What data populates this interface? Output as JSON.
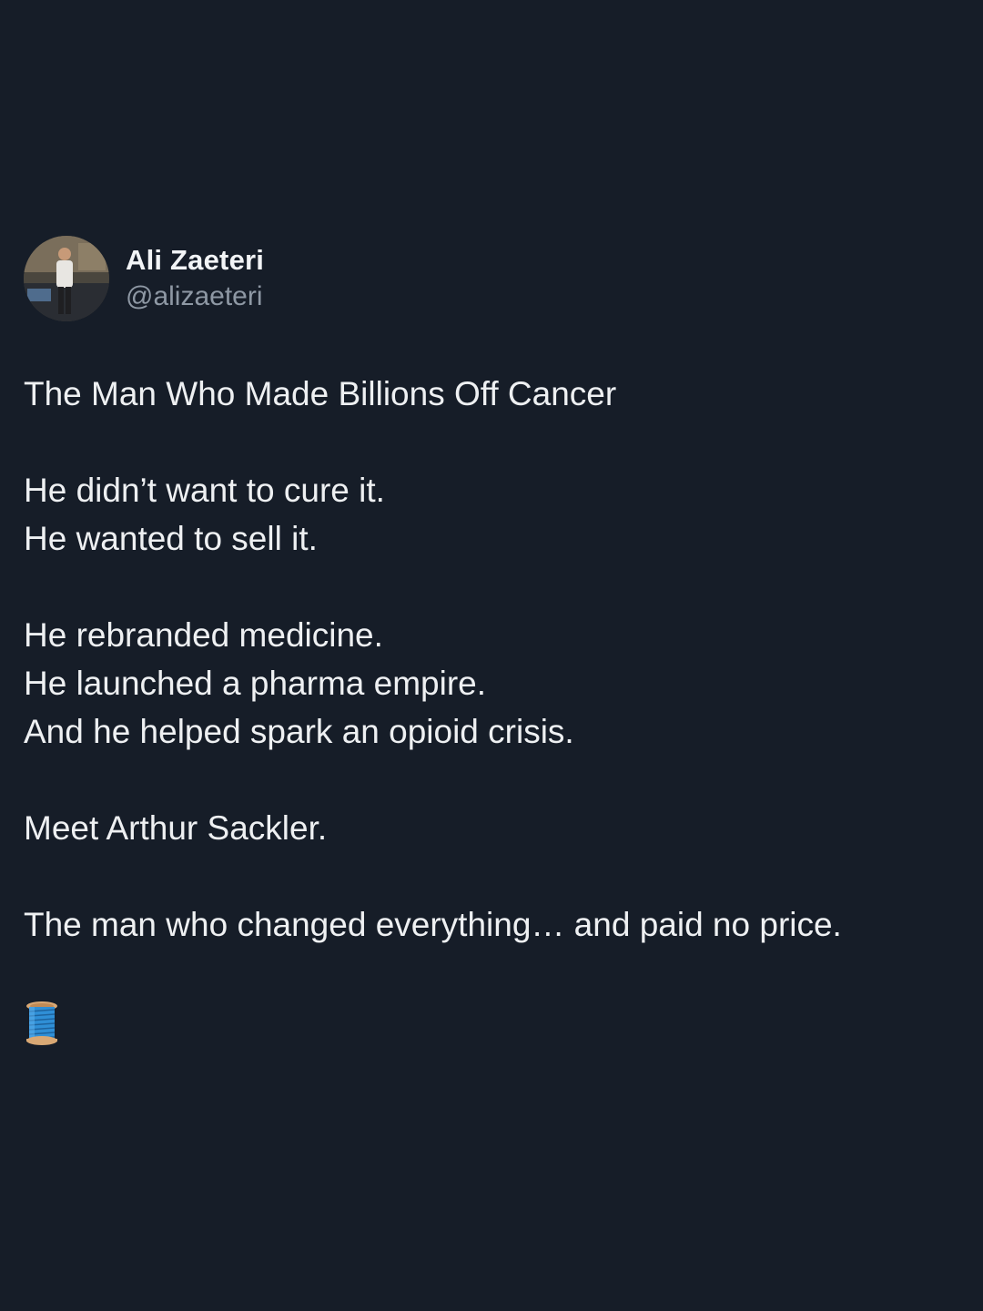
{
  "author": {
    "display_name": "Ali Zaeteri",
    "handle": "@alizaeteri"
  },
  "tweet": {
    "paragraphs": [
      [
        "The Man Who Made Billions Off Cancer"
      ],
      [
        "He didn’t want to cure it.",
        "He wanted to sell it."
      ],
      [
        "He rebranded medicine.",
        "He launched a pharma empire.",
        "And he helped spark an opioid crisis."
      ],
      [
        "Meet Arthur Sackler."
      ],
      [
        "The man who changed everything… and paid no price."
      ]
    ],
    "trailing_icon": "thread-spool-icon"
  },
  "colors": {
    "background": "#161d28",
    "text": "#eef0f2",
    "handle": "#8e98a4",
    "spool_thread": "#2f8fd6",
    "spool_wood": "#d9a874"
  }
}
